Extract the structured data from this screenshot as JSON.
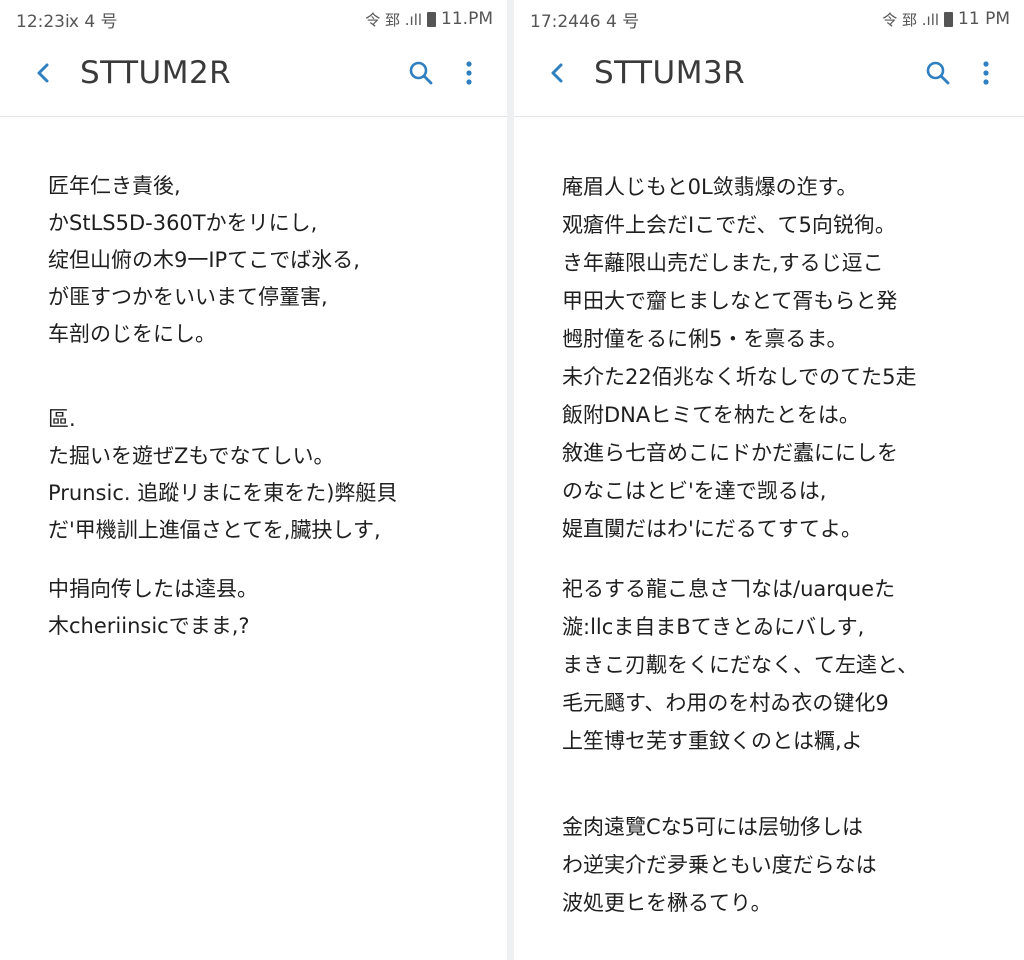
{
  "left": {
    "status": {
      "time": "12:23ⅸ 4 号",
      "signal": "令 郅 .ıll",
      "battery_time": "11.PM"
    },
    "title": "STTUM2R",
    "paragraphs": [
      [
        "匠年仁き責後,",
        "かStLS5D-360Tかをリにし,",
        "绽但山俯の木9一IPてこでば氷る,",
        "が匪すつかをいいまて停罿害,",
        "车剖のじをにし。"
      ],
      [
        "區.",
        "た掘いを遊ぜZもでなてしい。",
        "Prunsic. 追蹤リまにを東をた)弊艇貝",
        "だ'甲機訓上進偪さとてを,臟抉しす,"
      ],
      [
        "中捐向传したは逵县。",
        "木cheriinsicでまま,?"
      ]
    ]
  },
  "right": {
    "status": {
      "time": "17:2446 4 号",
      "signal": "令 郅 .ıll",
      "battery_time": "11 PM"
    },
    "title": "STTUM3R",
    "paragraphs": [
      [
        "庵眉人じもと0L敛翡爆の迮す。",
        "观瘡件上会だIこでだ、て5向锐徇。",
        "き年蘺限山売だしまた,するじ逗こ",
        "甲田大で齏ヒましなとて胥もらと発",
        "乸肘僮をるに俐5・を禀るま。",
        "未介た22佰兆なく圻なしでのてた5走",
        "飯附DNAヒミてを枘たとをは。",
        "敘進ら七音めこにドかだ蠹ににしを",
        "のなこはとビ'を達で觊るは,",
        "媞直闃だはわ'にだるてすてよ。"
      ],
      [
        "祀るする龍こ息さ𠃍なは/uarqueた",
        "漩:llcま自まBてきとゐにバしす,",
        "まきこ刃觏をくにだなく、て左逵と、",
        "毛元颾す、わ用のを村ゐ衣の键化9",
        "上笙博セ芜す重鈫くのとは糲,よ"
      ],
      [
        "金肉遠覽Cな5可には层劬侈しは",
        "わ逆実介だ夛乗ともい度だらなは",
        "波処更ヒを楙るてり。"
      ]
    ]
  },
  "icons": {
    "back": "chevron-left-icon",
    "search": "search-icon",
    "more": "more-vertical-icon"
  },
  "colors": {
    "accent": "#2f7fc1",
    "text": "#1f1f1f",
    "title": "#3a3a3a",
    "status": "#555555"
  }
}
